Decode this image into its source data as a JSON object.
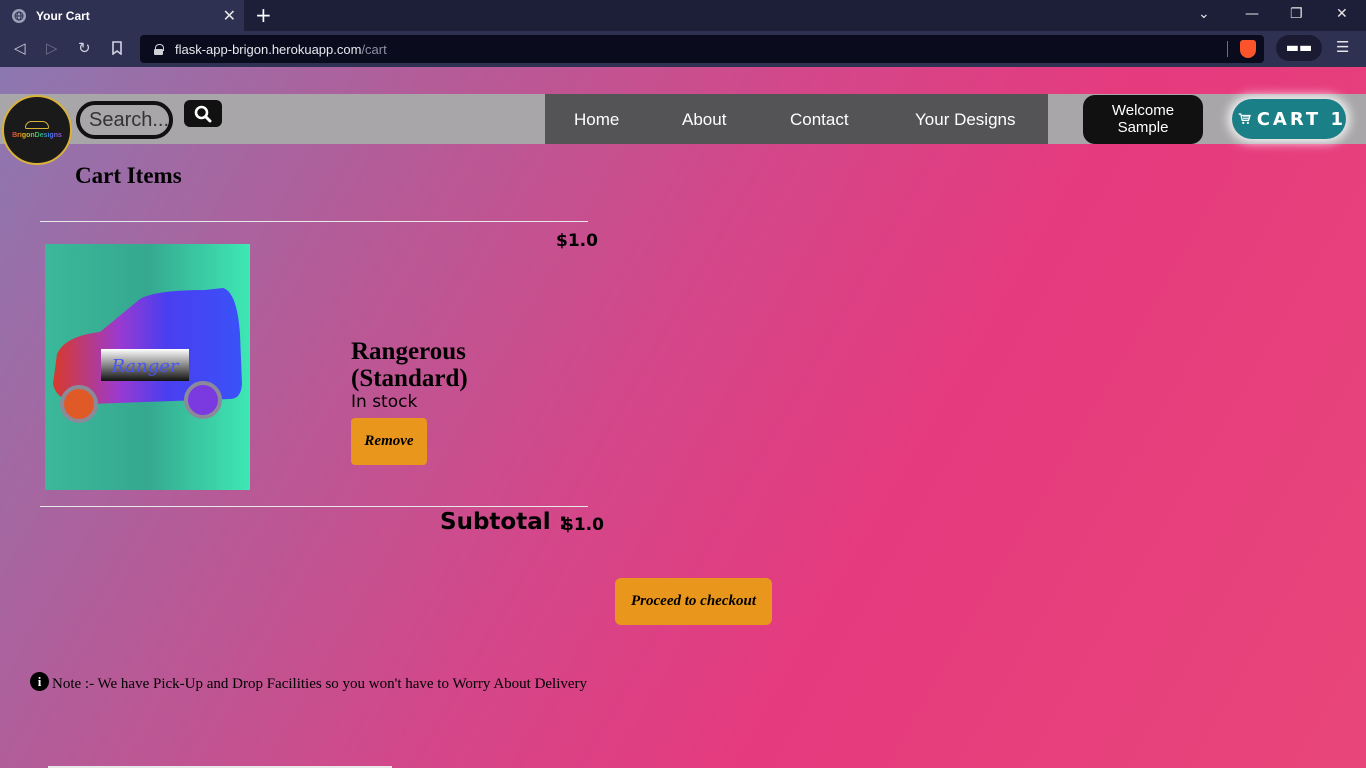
{
  "browser": {
    "tab_title": "Your Cart",
    "url_host": "flask-app-brigon.herokuapp.com",
    "url_path": "/cart"
  },
  "site": {
    "logo_text": "BrigonDesigns",
    "search_placeholder": "Search...",
    "nav": [
      {
        "label": "Home"
      },
      {
        "label": "About"
      },
      {
        "label": "Contact"
      },
      {
        "label": "Your Designs"
      }
    ],
    "welcome_line1": "Welcome",
    "welcome_line2": "Sample",
    "cart_label": "CART",
    "cart_count": "1"
  },
  "cart": {
    "heading": "Cart Items",
    "items": [
      {
        "price": "$1.0",
        "image_label": "Ranger",
        "name": "Rangerous (Standard)",
        "stock": "In stock",
        "remove_label": "Remove"
      }
    ],
    "subtotal_label": "Subtotal :",
    "subtotal_value": "$1.0",
    "checkout_label": "Proceed to checkout"
  },
  "note": "Note :- We have Pick-Up and Drop Facilities so you won't have to Worry About Delivery",
  "colors": {
    "accent_button": "#e8961c",
    "cart_button": "#1a7f86",
    "nav_background": "#545356"
  }
}
